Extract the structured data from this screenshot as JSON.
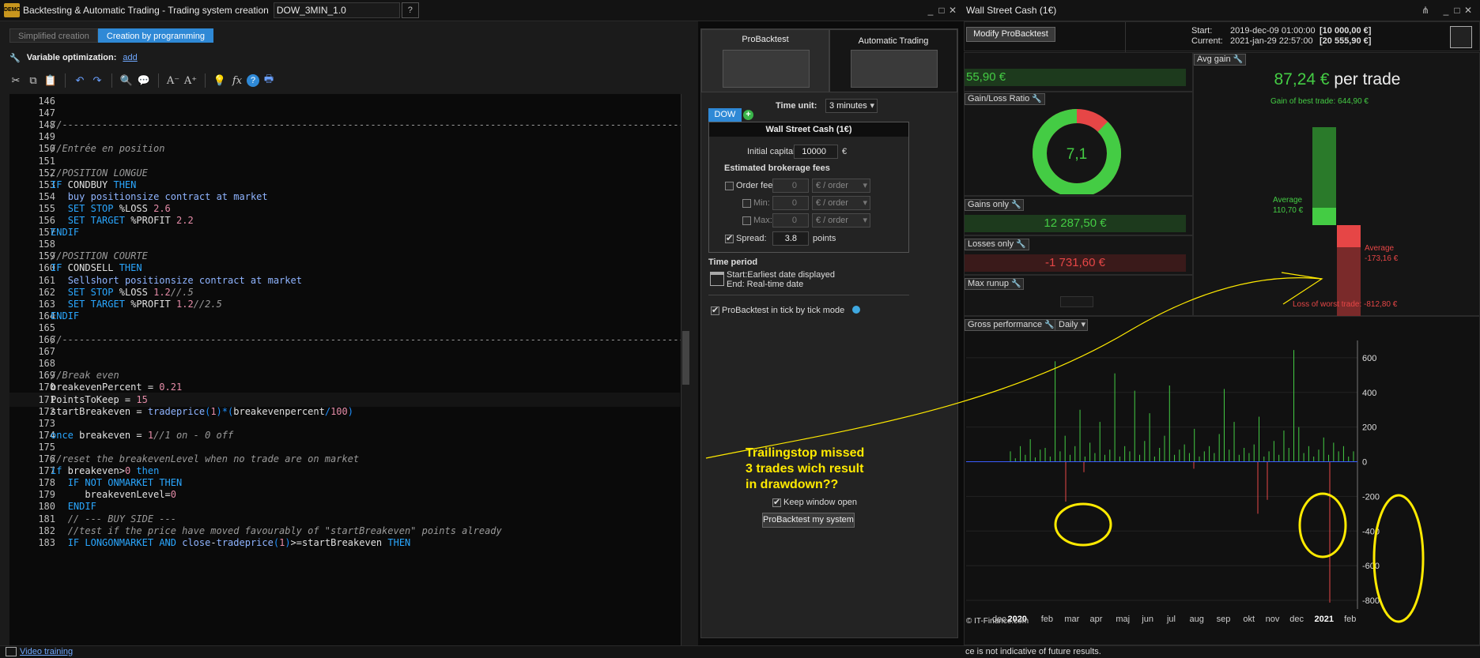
{
  "editor_window": {
    "title": "Backtesting & Automatic Trading - Trading system creation",
    "system_name": "DOW_3MIN_1.0"
  },
  "editor": {
    "tabs": [
      "Simplified creation",
      "Creation by programming"
    ],
    "variable_optimization_label": "Variable optimization:",
    "variable_optimization_link": "add",
    "code_lines": [
      {
        "n": "146",
        "t": ""
      },
      {
        "n": "147",
        "t": ""
      },
      {
        "n": "148",
        "t": "//-----------------------------------------------------------------------------------------------------------------"
      },
      {
        "n": "149",
        "t": ""
      },
      {
        "n": "150",
        "t": "//Entrée en position"
      },
      {
        "n": "151",
        "t": ""
      },
      {
        "n": "152",
        "t": "//POSITION LONGUE"
      },
      {
        "n": "153",
        "t": "IF CONDBUY THEN"
      },
      {
        "n": "154",
        "t": "   buy positionsize contract at market"
      },
      {
        "n": "155",
        "t": "   SET STOP %LOSS 2.6"
      },
      {
        "n": "156",
        "t": "   SET TARGET %PROFIT 2.2"
      },
      {
        "n": "157",
        "t": "ENDIF"
      },
      {
        "n": "158",
        "t": ""
      },
      {
        "n": "159",
        "t": "//POSITION COURTE"
      },
      {
        "n": "160",
        "t": "IF CONDSELL THEN"
      },
      {
        "n": "161",
        "t": "   Sellshort positionsize contract at market"
      },
      {
        "n": "162",
        "t": "   SET STOP %LOSS 1.2//.5"
      },
      {
        "n": "163",
        "t": "   SET TARGET %PROFIT 1.2//2.5"
      },
      {
        "n": "164",
        "t": "ENDIF"
      },
      {
        "n": "165",
        "t": ""
      },
      {
        "n": "166",
        "t": "//-----------------------------------------------------------------------------------------------------------------"
      },
      {
        "n": "167",
        "t": ""
      },
      {
        "n": "168",
        "t": ""
      },
      {
        "n": "169",
        "t": "//Break even"
      },
      {
        "n": "170",
        "t": "breakevenPercent = 0.21"
      },
      {
        "n": "171",
        "t": "PointsToKeep = 15"
      },
      {
        "n": "172",
        "t": "startBreakeven = tradeprice(1)*(breakevenpercent/100)"
      },
      {
        "n": "173",
        "t": ""
      },
      {
        "n": "174",
        "t": "once breakeven = 1//1 on - 0 off"
      },
      {
        "n": "175",
        "t": ""
      },
      {
        "n": "176",
        "t": "//reset the breakevenLevel when no trade are on market"
      },
      {
        "n": "177",
        "t": "if breakeven>0 then"
      },
      {
        "n": "178",
        "t": "   IF NOT ONMARKET THEN"
      },
      {
        "n": "179",
        "t": "      breakevenLevel=0"
      },
      {
        "n": "180",
        "t": "   ENDIF"
      },
      {
        "n": "181",
        "t": "   // --- BUY SIDE ---"
      },
      {
        "n": "182",
        "t": "   //test if the price have moved favourably of \"startBreakeven\" points already"
      },
      {
        "n": "183",
        "t": "   IF LONGONMARKET AND close-tradeprice(1)>=startBreakeven THEN"
      }
    ],
    "bottom_link": "Video training"
  },
  "probacktest": {
    "tab_probacktest": "ProBacktest",
    "tab_automatic": "Automatic Trading",
    "time_unit_label": "Time unit:",
    "time_unit_value": "3 minutes",
    "instrument_tab": "DOW",
    "instrument_name": "Wall Street Cash (1€)",
    "initial_capital_label": "Initial capital :",
    "initial_capital_value": "10000",
    "currency": "€",
    "brokerage_title": "Estimated brokerage fees",
    "order_fee_label": "Order fee :",
    "min_label": "Min:",
    "max_label": "Max:",
    "fee_value": "0",
    "fee_unit": "€ / order",
    "spread_label": "Spread:",
    "spread_value": "3.8",
    "spread_unit": "points",
    "time_period_title": "Time period",
    "time_period_start": "Start:Earliest date displayed",
    "time_period_end": "End:  Real-time date",
    "tick_mode_label": "ProBacktest in tick by tick mode",
    "keep_window_label": "Keep window open",
    "run_button": "ProBacktest my system"
  },
  "results": {
    "window_title": "Wall Street Cash (1€)",
    "modify_button": "Modify ProBacktest",
    "start_label": "Start:",
    "start_value": "2019-dec-09 01:00:00",
    "start_amount": "[10 000,00 €]",
    "current_label": "Current:",
    "current_value": "2021-jan-29 22:57:00",
    "current_amount": "[20 555,90 €]",
    "total_gain_partial": "55,90 €",
    "gain_loss_ratio_label": "Gain/Loss Ratio",
    "gain_loss_ratio_value": "7,1",
    "gain_loss_ratio_win_fraction": 0.877,
    "gains_only_label": "Gains only",
    "gains_only_value": "12 287,50 €",
    "losses_only_label": "Losses only",
    "losses_only_value": "-1 731,60 €",
    "max_runup_label": "Max runup",
    "avg_gain_label": "Avg gain",
    "avg_gain_value": "87,24 €",
    "avg_gain_suffix": "per trade",
    "best_trade_label": "Gain of best trade: 644,90 €",
    "average_gain_label": "Average",
    "average_gain_value": "110,70 €",
    "average_loss_label": "Average",
    "average_loss_value": "-173,16 €",
    "worst_trade_label": "Loss of worst trade: -812,80 €",
    "gross_perf_label": "Gross performance",
    "period_select": "Daily",
    "copyright": "© IT-Finance.com",
    "disclaimer": "ce is not indicative of future results.",
    "colors": {
      "gain": "#44cc44",
      "loss": "#e64646",
      "axis_blue": "#3a5cff"
    }
  },
  "annotation": {
    "line1": "Trailingstop missed",
    "line2": "3 trades wich result",
    "line3": "in drawdown??",
    "color": "#ffea00"
  },
  "chart_data": {
    "type": "bar",
    "title": "",
    "xlabel": "",
    "ylabel": "",
    "ylim": [
      -850,
      700
    ],
    "yticks": [
      600,
      400,
      200,
      0,
      -200,
      -400,
      -600,
      -800
    ],
    "x_tick_labels": [
      "dec",
      "2020",
      "feb",
      "mar",
      "apr",
      "maj",
      "jun",
      "jul",
      "aug",
      "sep",
      "okt",
      "nov",
      "dec",
      "2021",
      "feb"
    ],
    "series": [
      {
        "values": [
          60,
          20,
          90,
          40,
          130,
          25,
          70,
          80,
          30,
          580,
          60,
          150,
          40,
          90,
          300,
          30,
          110,
          50,
          230,
          40,
          70,
          510,
          30,
          90,
          60,
          410,
          40,
          120,
          280,
          30,
          80,
          150,
          440,
          40,
          70,
          100,
          50,
          190,
          30,
          60,
          90,
          50,
          160,
          420,
          70,
          230,
          40,
          80,
          50,
          100,
          260,
          30,
          60,
          120,
          40,
          180,
          80,
          645,
          200,
          50,
          90,
          30,
          70,
          140,
          40,
          110,
          60,
          90,
          30,
          60
        ]
      },
      {
        "values": [
          -230,
          -60,
          -40,
          -300,
          -220,
          -813
        ]
      }
    ]
  }
}
